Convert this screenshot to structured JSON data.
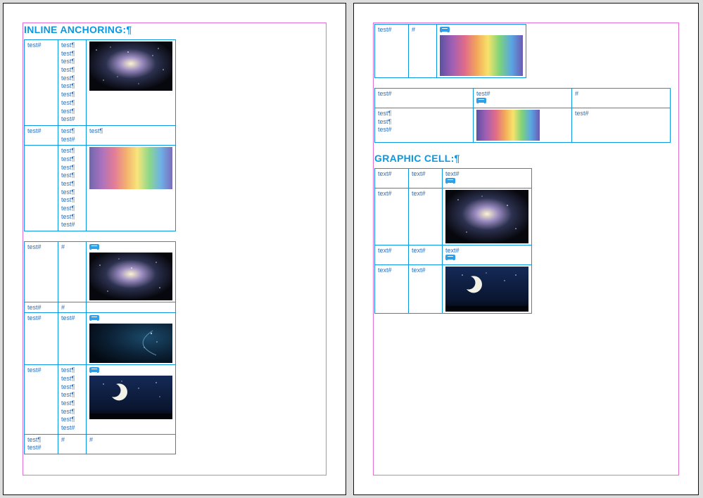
{
  "invisibles": {
    "pilcrow": "¶",
    "hash": "#"
  },
  "pageLeft": {
    "heading": "INLINE ANCHORING:¶",
    "table1": {
      "r1c1": "test#",
      "r1c2_lines": [
        "test¶",
        "test¶",
        "test¶",
        "test¶",
        "test¶",
        "test¶",
        "test¶",
        "test¶",
        "test¶",
        "test#"
      ],
      "r2c1": "test#",
      "r2c2_lines": [
        "test¶",
        "test#"
      ],
      "r2c3": "test¶",
      "r3c2_lines": [
        "test¶",
        "test¶",
        "test¶",
        "test¶",
        "test¶",
        "test¶",
        "test¶",
        "test¶",
        "test¶",
        "test#"
      ]
    },
    "table2": {
      "r1c1": "test#",
      "r1c2": "#",
      "r2c1": "test#",
      "r2c2": "#",
      "r3c1": "test#",
      "r3c2": "test#",
      "r4c1": "test#",
      "r4c2_lines": [
        "test¶",
        "test¶",
        "test¶",
        "test¶",
        "test¶",
        "test¶",
        "test¶",
        "test#"
      ],
      "r5c1_lines": [
        "test¶",
        "test#"
      ],
      "r5c2": "#",
      "r5c3": "#"
    }
  },
  "pageRight": {
    "tableTop": {
      "r1c1": "test#",
      "r1c2": "#"
    },
    "tableMid": {
      "h1": "test#",
      "h2": "test#",
      "h3": "#",
      "r1c1_lines": [
        "test¶",
        "test¶",
        "test#"
      ],
      "r1c3": "test#"
    },
    "heading": "GRAPHIC CELL:¶",
    "tableCells": {
      "h1": "text#",
      "h2": "text#",
      "h3": "text#",
      "r1c1": "text#",
      "r1c2": "text#",
      "h4": "text#",
      "h5": "text#",
      "h6": "text#",
      "r2c1": "text#",
      "r2c2": "text#"
    }
  },
  "images": {
    "galaxy": "galaxy-image",
    "rainbow": "rainbow-gradient-image",
    "swirl": "dark-swirl-image",
    "moon": "crescent-moon-night-image"
  }
}
